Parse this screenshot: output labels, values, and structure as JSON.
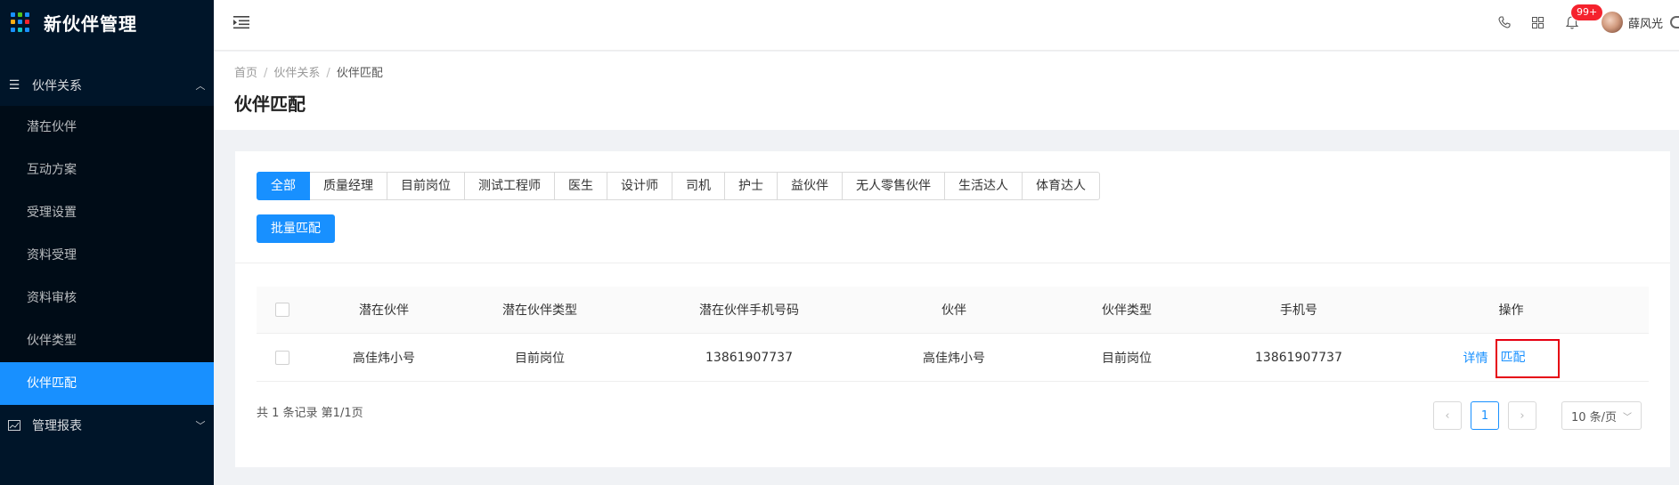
{
  "app": {
    "title": "新伙伴管理"
  },
  "sidebar": {
    "group1": {
      "label": "伙伴关系",
      "items": [
        "潜在伙伴",
        "互动方案",
        "受理设置",
        "资料受理",
        "资料审核",
        "伙伴类型",
        "伙伴匹配"
      ],
      "active_index": 6
    },
    "group2": {
      "label": "管理报表"
    }
  },
  "header": {
    "badge": "99+",
    "username": "薛风光"
  },
  "breadcrumb": [
    "首页",
    "伙伴关系",
    "伙伴匹配"
  ],
  "page": {
    "title": "伙伴匹配"
  },
  "tabs": [
    "全部",
    "质量经理",
    "目前岗位",
    "测试工程师",
    "医生",
    "设计师",
    "司机",
    "护士",
    "益伙伴",
    "无人零售伙伴",
    "生活达人",
    "体育达人"
  ],
  "batch_button": "批量匹配",
  "table": {
    "columns": [
      "潜在伙伴",
      "潜在伙伴类型",
      "潜在伙伴手机号码",
      "伙伴",
      "伙伴类型",
      "手机号",
      "操作"
    ],
    "rows": [
      [
        "高佳炜小号",
        "目前岗位",
        "13861907737",
        "高佳炜小号",
        "目前岗位",
        "13861907737"
      ]
    ],
    "actions": {
      "detail": "详情",
      "match": "匹配"
    }
  },
  "pagination": {
    "summary": "共 1 条记录 第1/1页",
    "current": "1",
    "page_size": "10 条/页"
  },
  "colors": {
    "accent": "#1890ff",
    "sidebar": "#001529",
    "highlight": "#e60012"
  }
}
